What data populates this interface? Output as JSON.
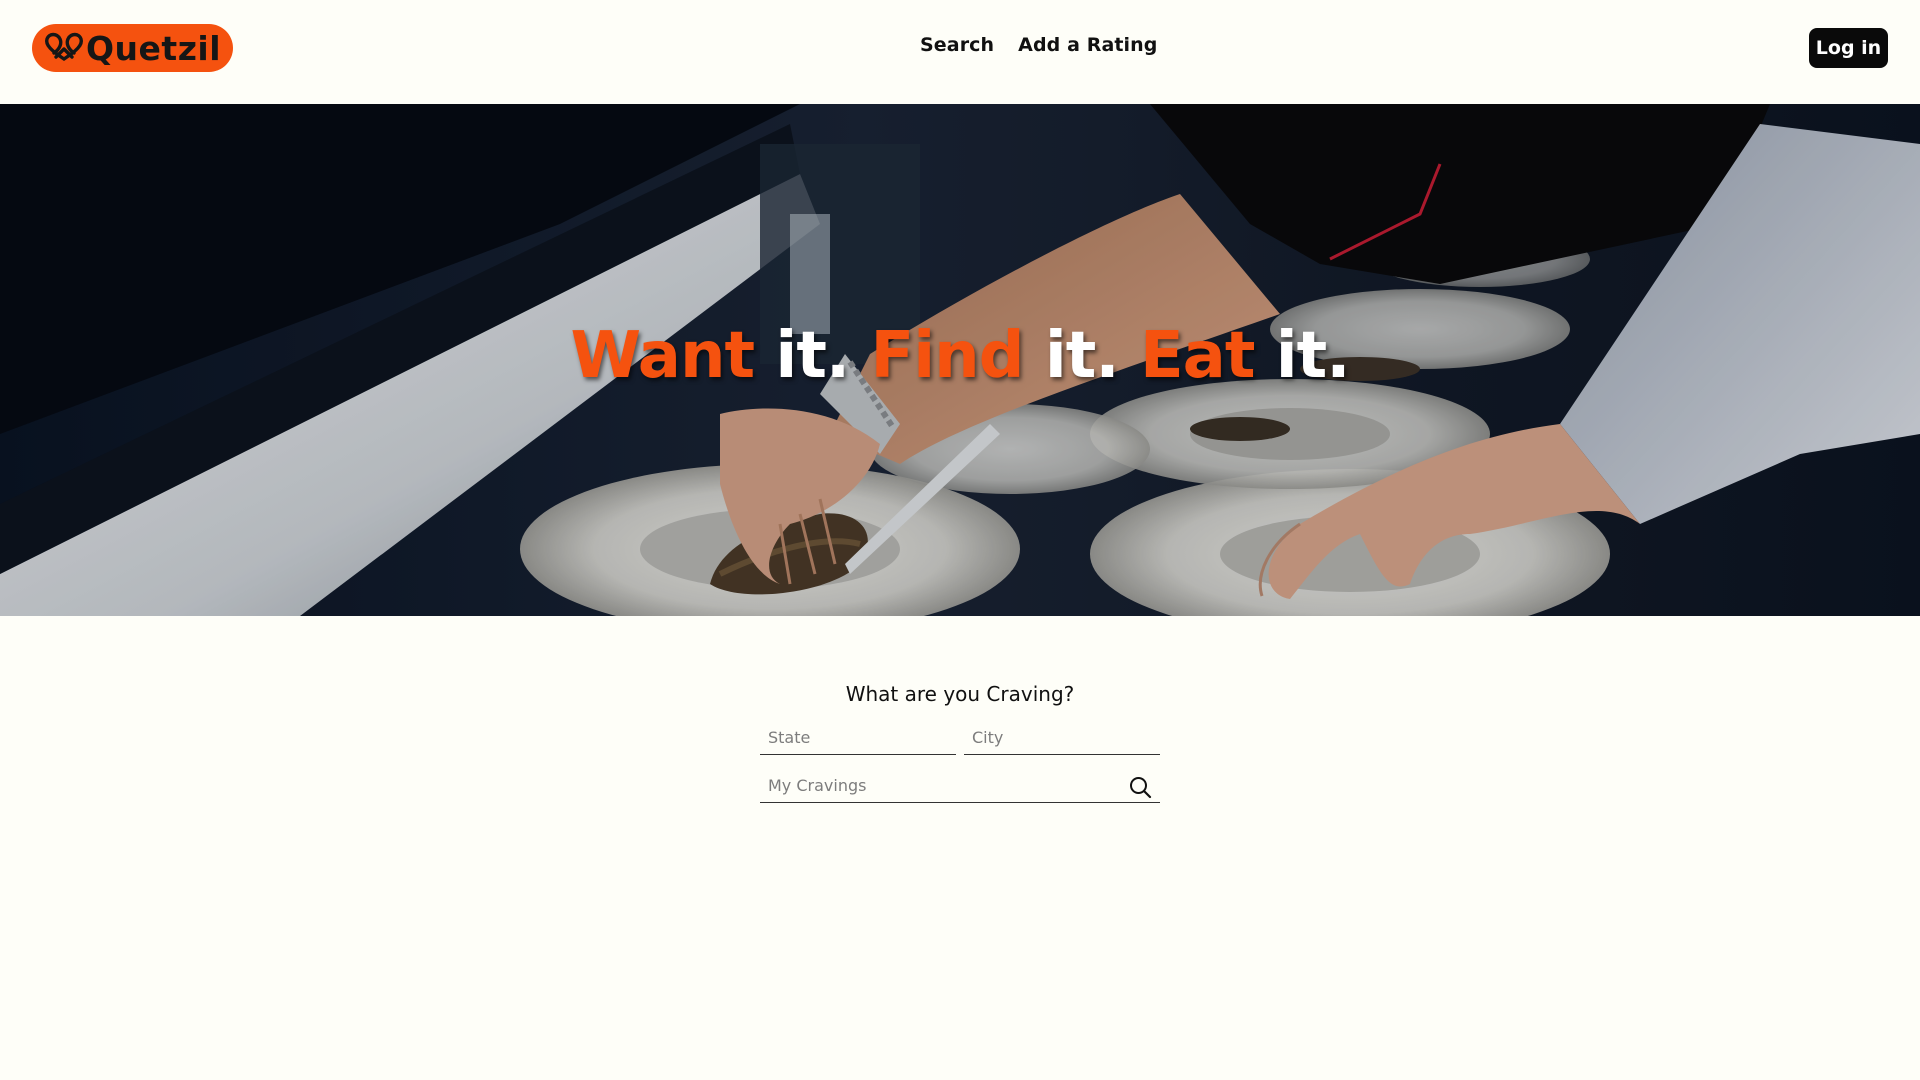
{
  "brand": {
    "name": "Quetzil",
    "logo_color": "#f5520f"
  },
  "nav": {
    "items": [
      "Search",
      "Add a Rating"
    ],
    "login_label": "Log in"
  },
  "hero": {
    "tagline": [
      {
        "text": "Want",
        "accent": true
      },
      {
        "text": " it. ",
        "accent": false
      },
      {
        "text": "Find",
        "accent": true
      },
      {
        "text": " it. ",
        "accent": false
      },
      {
        "text": "Eat",
        "accent": true
      },
      {
        "text": " it.",
        "accent": false
      }
    ],
    "accent_color": "#f5520f"
  },
  "search": {
    "title": "What are you Craving?",
    "state_placeholder": "State",
    "city_placeholder": "City",
    "cravings_placeholder": "My Cravings",
    "icon": "search-icon"
  }
}
